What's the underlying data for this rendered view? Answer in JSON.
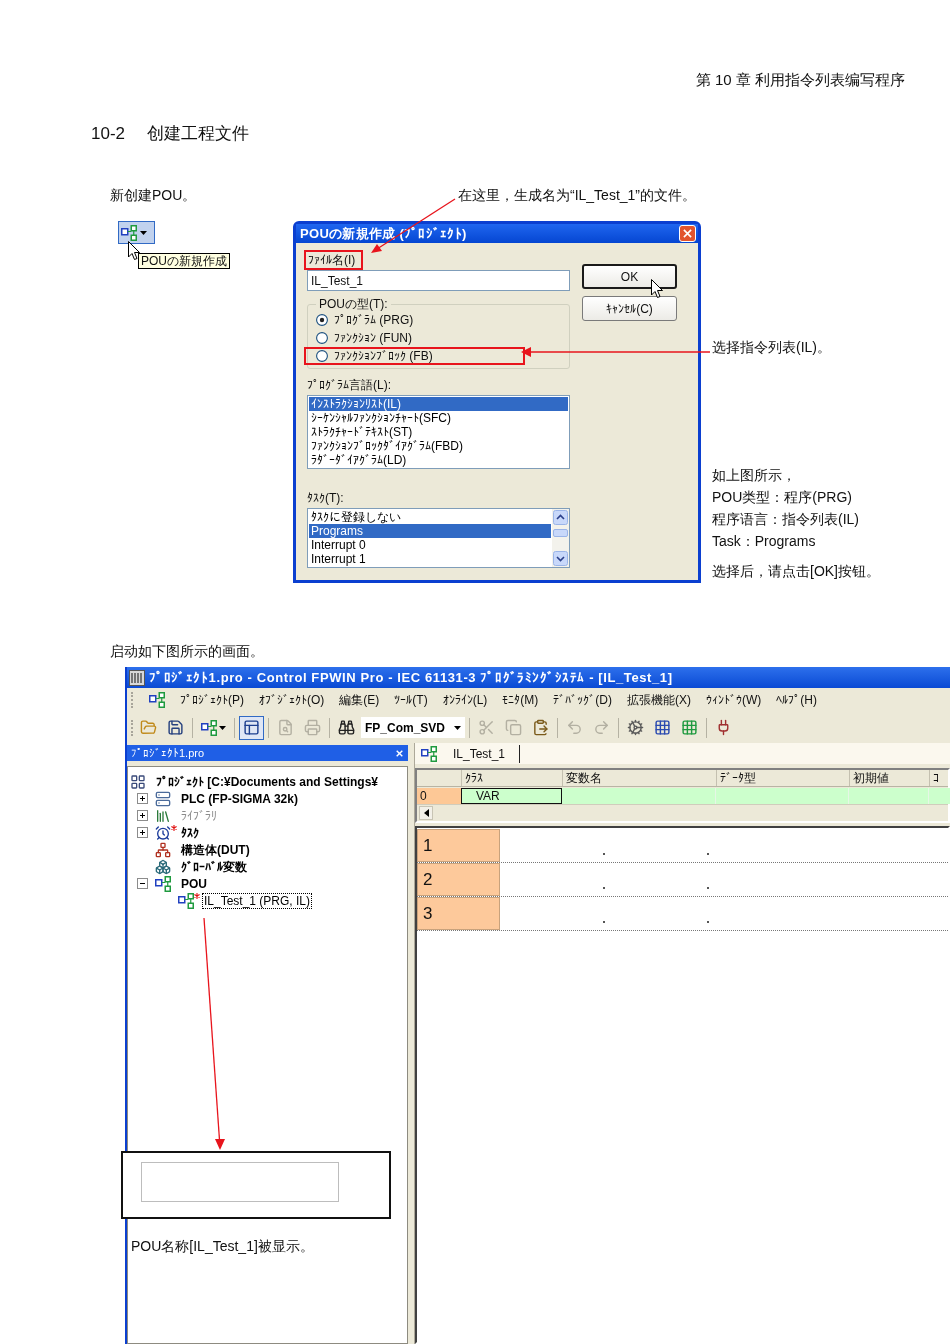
{
  "page_header": {
    "chapter": "第 10 章 利用指令列表编写程序"
  },
  "section": {
    "number": "10-2",
    "title": "创建工程文件"
  },
  "step_new_pou": {
    "caption": "新创建POU。",
    "button_tooltip": "POUの新規作成",
    "note": "在这里，生成名为“IL_Test_1”的文件。"
  },
  "dialog": {
    "title": "POUの新規作成 (ﾌﾟﾛｼﾞｪｸﾄ)",
    "file_name": {
      "label": "ﾌｧｲﾙ名(I)",
      "value": "IL_Test_1",
      "highlighted": true
    },
    "pou_type": {
      "label": "POUの型(T):",
      "options": [
        {
          "label": "ﾌﾟﾛｸﾞﾗﾑ (PRG)",
          "selected": true,
          "highlighted": false
        },
        {
          "label": "ﾌｧﾝｸｼｮﾝ (FUN)",
          "selected": false,
          "highlighted": false
        },
        {
          "label": "ﾌｧﾝｸｼｮﾝﾌﾞﾛｯｸ (FB)",
          "selected": false,
          "highlighted": true
        }
      ]
    },
    "language": {
      "label": "ﾌﾟﾛｸﾞﾗﾑ言語(L):",
      "items": [
        {
          "label": "ｲﾝｽﾄﾗｸｼｮﾝﾘｽﾄ(IL)",
          "selected": true
        },
        {
          "label": "ｼｰｹﾝｼｬﾙﾌｧﾝｸｼｮﾝﾁｬｰﾄ(SFC)",
          "selected": false
        },
        {
          "label": "ｽﾄﾗｸﾁｬｰﾄﾞﾃｷｽﾄ(ST)",
          "selected": false
        },
        {
          "label": "ﾌｧﾝｸｼｮﾝﾌﾞﾛｯｸﾀﾞｲｱｸﾞﾗﾑ(FBD)",
          "selected": false
        },
        {
          "label": "ﾗﾀﾞｰﾀﾞｲｱｸﾞﾗﾑ(LD)",
          "selected": false
        }
      ]
    },
    "task": {
      "label": "ﾀｽｸ(T):",
      "items": [
        {
          "label": "ﾀｽｸに登録しない",
          "selected": false
        },
        {
          "label": "Programs",
          "selected": true
        },
        {
          "label": "Interrupt 0",
          "selected": false
        },
        {
          "label": "Interrupt 1",
          "selected": false
        }
      ]
    },
    "buttons": [
      {
        "label": "OK",
        "default": true
      },
      {
        "label": "ｷｬﾝｾﾙ(C)",
        "default": false
      }
    ]
  },
  "callout": {
    "text": "选择指令列表(IL)。"
  },
  "summary": {
    "lines": [
      "如上图所示，",
      "POU类型：程序(PRG)",
      "程序语言：指令列表(IL)",
      "Task：Programs"
    ],
    "instruction": "选择后，请点击[OK]按钮。"
  },
  "step_start": {
    "caption": "启动如下图所示的画面。"
  },
  "app": {
    "title": "ﾌﾟﾛｼﾞｪｸﾄ1.pro - Control FPWIN Pro - IEC 61131-3 ﾌﾟﾛｸﾞﾗﾐﾝｸﾞｼｽﾃﾑ - [IL_Test_1]",
    "menu": [
      "ﾌﾟﾛｼﾞｪｸﾄ(P)",
      "ｵﾌﾞｼﾞｪｸﾄ(O)",
      "編集(E)",
      "ﾂｰﾙ(T)",
      "ｵﾝﾗｲﾝ(L)",
      "ﾓﾆﾀ(M)",
      "ﾃﾞﾊﾞｯｸﾞ(D)",
      "拡張機能(X)",
      "ｳｨﾝﾄﾞｳ(W)",
      "ﾍﾙﾌﾟ(H)"
    ],
    "toolbar": {
      "groups": [
        [
          {
            "kind": "open",
            "disabled": false,
            "pressed": false
          },
          {
            "kind": "save",
            "disabled": false,
            "pressed": false
          }
        ],
        [
          {
            "kind": "new-pou",
            "disabled": false,
            "pressed": false
          }
        ],
        [
          {
            "kind": "window",
            "disabled": false,
            "pressed": true
          }
        ],
        [
          {
            "kind": "preview",
            "disabled": true,
            "pressed": false
          },
          {
            "kind": "print",
            "disabled": true,
            "pressed": false
          }
        ],
        [
          {
            "kind": "find",
            "disabled": false,
            "pressed": false
          },
          {
            "kind": "selector",
            "value": "FP_Com_SVD",
            "disabled": false,
            "pressed": false
          }
        ],
        [
          {
            "kind": "cut",
            "disabled": true,
            "pressed": false
          },
          {
            "kind": "copy",
            "disabled": true,
            "pressed": false
          },
          {
            "kind": "paste",
            "disabled": false,
            "pressed": false
          }
        ],
        [
          {
            "kind": "undo",
            "disabled": true,
            "pressed": false
          },
          {
            "kind": "redo",
            "disabled": true,
            "pressed": false
          }
        ],
        [
          {
            "kind": "build",
            "disabled": false,
            "pressed": false
          },
          {
            "kind": "build-all",
            "disabled": false,
            "pressed": false
          },
          {
            "kind": "rebuild",
            "disabled": false,
            "pressed": false
          }
        ],
        [
          {
            "kind": "online",
            "disabled": false,
            "pressed": false
          }
        ]
      ]
    },
    "project_panel": {
      "title": "ﾌﾟﾛｼﾞｪｸﾄ1.pro",
      "tree": [
        {
          "label": "ﾌﾟﾛｼﾞｪｸﾄ [C:¥Documents and Settings¥",
          "kind": "project",
          "selected": false,
          "dimmed": false,
          "modified": false,
          "children": [
            {
              "label": "PLC (FP-SIGMA 32k)",
              "kind": "plc",
              "expanded": false,
              "selected": false,
              "dimmed": false,
              "modified": false
            },
            {
              "label": "ﾗｲﾌﾞﾗﾘ",
              "kind": "library",
              "expanded": false,
              "selected": false,
              "dimmed": true,
              "modified": false
            },
            {
              "label": "ﾀｽｸ",
              "kind": "task",
              "expanded": false,
              "selected": false,
              "dimmed": false,
              "modified": true
            },
            {
              "label": "構造体(DUT)",
              "kind": "dut",
              "selected": false,
              "dimmed": false,
              "modified": false
            },
            {
              "label": "ｸﾞﾛｰﾊﾞﾙ変数",
              "kind": "global",
              "selected": false,
              "dimmed": false,
              "modified": false
            },
            {
              "label": "POU",
              "kind": "pou",
              "expanded": true,
              "selected": false,
              "dimmed": false,
              "modified": false,
              "children": [
                {
                  "label": "IL_Test_1 (PRG, IL)",
                  "kind": "program",
                  "selected": true,
                  "dimmed": false,
                  "modified": true
                }
              ]
            }
          ]
        }
      ]
    },
    "editor": {
      "tab": "IL_Test_1",
      "columns": [
        "ｸﾗｽ",
        "変数名",
        "ﾃﾞｰﾀ型",
        "初期値",
        "ｺ"
      ],
      "rows": [
        {
          "number": "0",
          "class": "VAR"
        }
      ],
      "lines": [
        "1",
        "2",
        "3"
      ]
    }
  },
  "inset": {
    "caption": "POU名称[IL_Test_1]被显示。"
  }
}
